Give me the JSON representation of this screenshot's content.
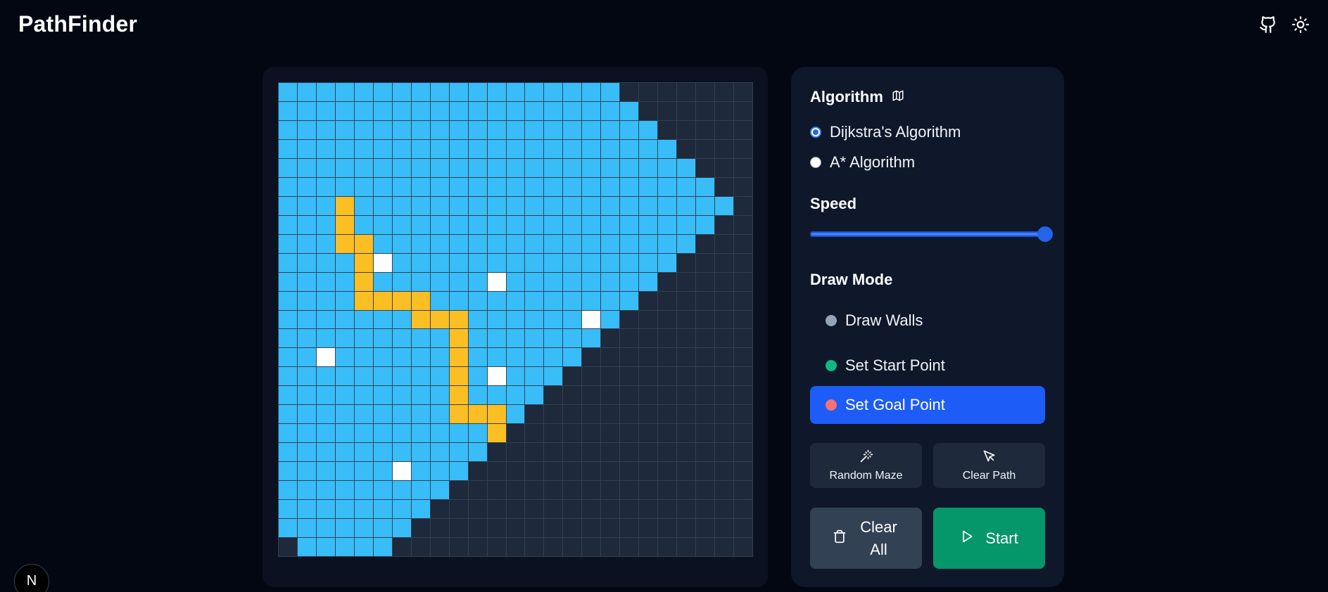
{
  "app": {
    "title": "PathFinder"
  },
  "header": {
    "icons": [
      "github-icon",
      "sun-icon"
    ]
  },
  "grid": {
    "rows": 25,
    "cols": 25,
    "visited_extent": [
      18,
      19,
      20,
      21,
      22,
      23,
      24,
      23,
      22,
      21,
      20,
      19,
      18,
      17,
      16,
      15,
      14,
      13,
      12,
      11,
      10,
      9,
      8,
      7,
      6
    ],
    "last_row_visited": [
      1,
      2,
      3,
      4,
      5
    ],
    "path_cells": [
      [
        6,
        3
      ],
      [
        7,
        3
      ],
      [
        8,
        3
      ],
      [
        8,
        4
      ],
      [
        9,
        4
      ],
      [
        10,
        4
      ],
      [
        11,
        4
      ],
      [
        11,
        5
      ],
      [
        11,
        6
      ],
      [
        11,
        7
      ],
      [
        12,
        7
      ],
      [
        12,
        8
      ],
      [
        12,
        9
      ],
      [
        13,
        9
      ],
      [
        14,
        9
      ],
      [
        15,
        9
      ],
      [
        16,
        9
      ],
      [
        17,
        9
      ],
      [
        17,
        10
      ],
      [
        17,
        11
      ],
      [
        18,
        11
      ]
    ],
    "wall_cells": [
      [
        9,
        5
      ],
      [
        10,
        11
      ],
      [
        12,
        16
      ],
      [
        14,
        2
      ],
      [
        15,
        11
      ],
      [
        20,
        6
      ]
    ],
    "colors": {
      "unvisited": "#1e293b",
      "visited": "#38bdf8",
      "path": "#fbbf24",
      "wall": "#ffffff",
      "grid_line": "#334155"
    }
  },
  "panel": {
    "algorithm_title": "Algorithm",
    "algorithms": [
      {
        "label": "Dijkstra's Algorithm",
        "checked": true
      },
      {
        "label": "A* Algorithm",
        "checked": false
      }
    ],
    "speed_title": "Speed",
    "speed_value": 1.0,
    "draw_mode_title": "Draw Mode",
    "modes": [
      {
        "label": "Draw Walls",
        "dot_color": "#94a3b8",
        "active": false
      },
      {
        "label": "Set Start Point",
        "dot_color": "#10b981",
        "active": false
      },
      {
        "label": "Set Goal Point",
        "dot_color": "#f87171",
        "active": true
      }
    ],
    "random_maze_label": "Random Maze",
    "clear_path_label": "Clear Path",
    "clear_all_label": "Clear All",
    "start_label": "Start"
  },
  "badge": {
    "text": "N"
  },
  "accent_color": "#1d5cf7",
  "start_color": "#059669"
}
